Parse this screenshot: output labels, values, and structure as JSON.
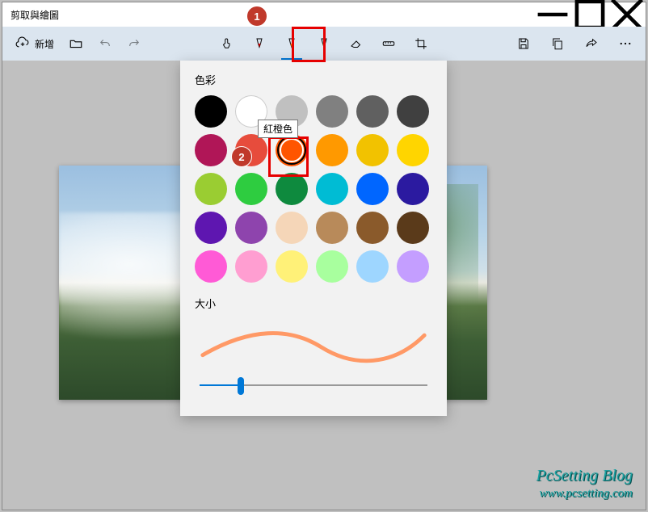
{
  "window": {
    "title": "剪取與繪圖"
  },
  "toolbar": {
    "new_label": "新增"
  },
  "panel": {
    "color_label": "色彩",
    "size_label": "大小",
    "tooltip": "紅橙色",
    "slider_value": 18,
    "selected_index": 8,
    "colors": [
      {
        "hex": "#000000"
      },
      {
        "hex": "#ffffff"
      },
      {
        "hex": "#c0c0c0"
      },
      {
        "hex": "#808080"
      },
      {
        "hex": "#606060"
      },
      {
        "hex": "#404040"
      },
      {
        "hex": "#b01657"
      },
      {
        "hex": "#e74c3c"
      },
      {
        "hex": "#ff5500"
      },
      {
        "hex": "#ff9900"
      },
      {
        "hex": "#f2c200"
      },
      {
        "hex": "#ffd500"
      },
      {
        "hex": "#9acd32"
      },
      {
        "hex": "#2ecc40"
      },
      {
        "hex": "#0e8a3e"
      },
      {
        "hex": "#00bcd4"
      },
      {
        "hex": "#0066ff"
      },
      {
        "hex": "#2b1aa0"
      },
      {
        "hex": "#5e16b0"
      },
      {
        "hex": "#8e44ad"
      },
      {
        "hex": "#f5d6b8"
      },
      {
        "hex": "#b88a5a"
      },
      {
        "hex": "#8a5a2b"
      },
      {
        "hex": "#5a3a1a"
      },
      {
        "hex": "#ff5ad6"
      },
      {
        "hex": "#ff9ed1"
      },
      {
        "hex": "#fff178"
      },
      {
        "hex": "#a8ff9e"
      },
      {
        "hex": "#9ed6ff"
      },
      {
        "hex": "#c49eff"
      }
    ]
  },
  "callouts": {
    "c1": "1",
    "c2": "2"
  },
  "watermark": {
    "line1": "PcSetting Blog",
    "line2": "www.pcsetting.com"
  }
}
